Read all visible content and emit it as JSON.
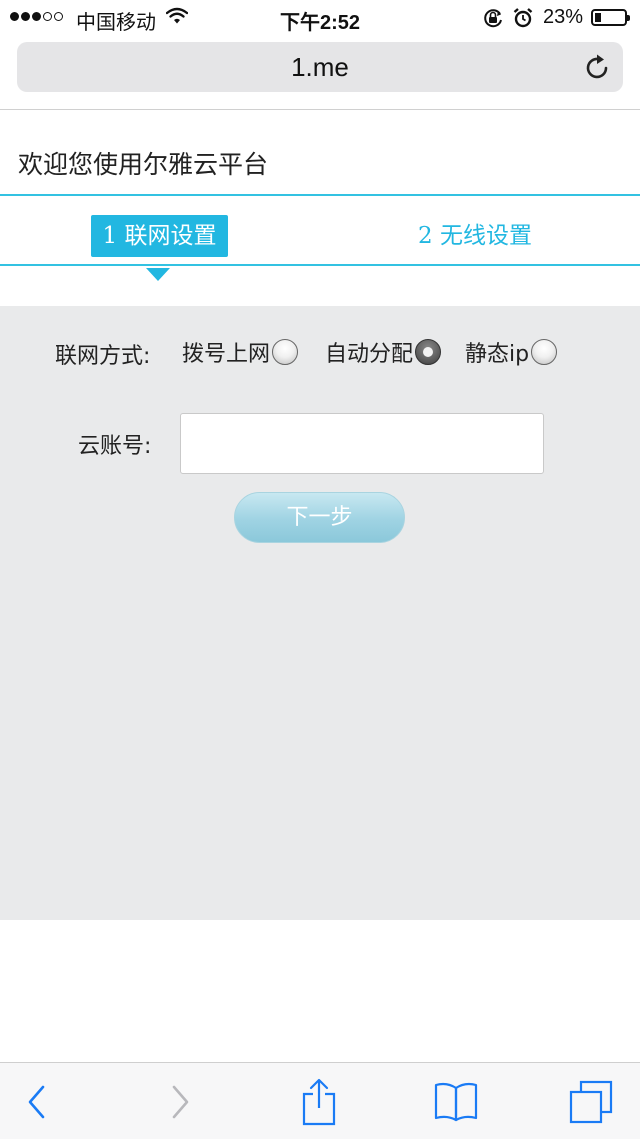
{
  "status_bar": {
    "carrier": "中国移动",
    "time": "下午2:52",
    "battery": "23%",
    "battery_level": 0.23
  },
  "browser": {
    "url": "1.me",
    "icons": [
      "reload-icon",
      "back-icon",
      "forward-icon",
      "share-icon",
      "bookmarks-icon",
      "tabs-icon"
    ]
  },
  "page": {
    "welcome": "欢迎您使用尔雅云平台",
    "steps": [
      {
        "label": "1 联网设置",
        "active": true
      },
      {
        "label": "2  无线设置",
        "active": false
      }
    ]
  },
  "form": {
    "connection_label": "联网方式:",
    "options": [
      {
        "label": "拨号上网",
        "checked": false
      },
      {
        "label": "自动分配",
        "checked": true
      },
      {
        "label": "静态ip",
        "checked": false
      }
    ],
    "account_label": "云账号:",
    "account_value": "",
    "next_label": "下一步"
  },
  "colors": {
    "accent": "#22b7e1",
    "panel_bg": "#e9eaeb",
    "ios_blue": "#1a7bf5"
  }
}
